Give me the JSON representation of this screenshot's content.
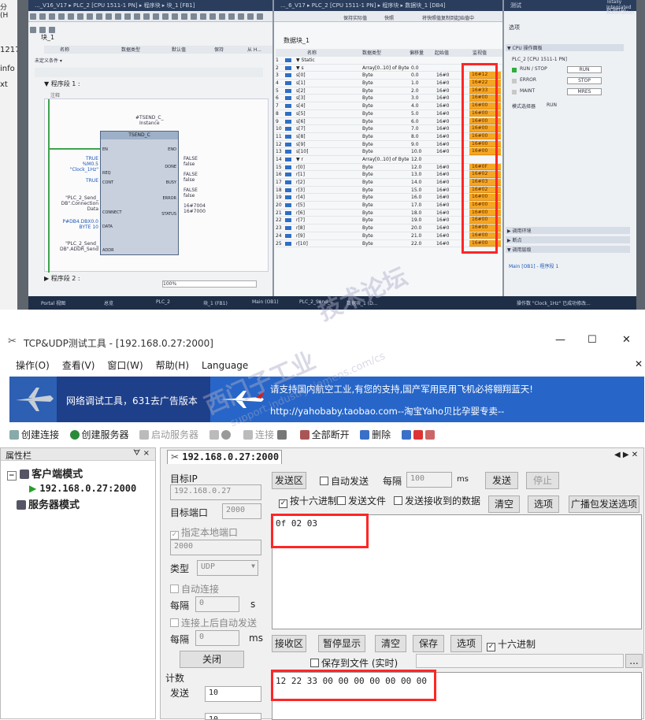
{
  "left_edge": {
    "fragments": [
      "分 (H",
      "1217",
      "info",
      "xt"
    ]
  },
  "tia": {
    "fb_title": "..._V16_V17 ▸ PLC_2 [CPU 1511-1 PN] ▸ 程序块 ▸ 块_1 [FB1]",
    "db_title": "..._6_V17 ▸ PLC_2 [CPU 1511-1 PN] ▸ 程序块 ▸ 数据块_1 [DB4]",
    "fb_header": "块_1",
    "fb_cols": [
      "名称",
      "数据类型",
      "默认值",
      "保持",
      "从 H..."
    ],
    "segment_comment": "未定义条件 ▾",
    "network1": "▼   程序段 1 :",
    "network1_comment": "注释",
    "network2": "▶   程序段 2 :",
    "zoom": "100%",
    "instance_db": "#TSEND_C_\nInstance",
    "fb_name": "TSEND_C",
    "pins_left": [
      "EN",
      "REQ",
      "CONT",
      "CONNECT",
      "DATA",
      "ADDR"
    ],
    "pins_right": [
      "ENO",
      "DONE",
      "BUSY",
      "ERROR",
      "STATUS"
    ],
    "left_values": [
      "TRUE\n%M0.5\n\"Clock_1Hz\"",
      "TRUE",
      "\"PLC_2_Send_\nDB\".Connection\nData",
      "P#DB4.DBX0.0\nBYTE 10",
      "\"PLC_2_Send_\nDB\".ADDR_Send"
    ],
    "right_values": [
      "FALSE\nfalse",
      "FALSE\nfalse",
      "FALSE\nfalse",
      "16#7004\n16#7000"
    ],
    "db_header": "数据块_1",
    "db_cols": [
      "名称",
      "数据类型",
      "偏移量",
      "起始值",
      "监视值"
    ],
    "db_toolbar": [
      "保持实际值",
      "快照",
      "将快照值复制到起始值中"
    ],
    "db_rows": [
      {
        "n": "1",
        "name": "▼ Static",
        "type": "",
        "offset": "",
        "start": "",
        "mon": ""
      },
      {
        "n": "2",
        "name": "  ▼ s",
        "type": "Array[0..10] of Byte",
        "offset": "0.0",
        "start": "",
        "mon": ""
      },
      {
        "n": "3",
        "name": "      s[0]",
        "type": "Byte",
        "offset": "0.0",
        "start": "16#0",
        "mon": "16#12"
      },
      {
        "n": "4",
        "name": "      s[1]",
        "type": "Byte",
        "offset": "1.0",
        "start": "16#0",
        "mon": "16#22"
      },
      {
        "n": "5",
        "name": "      s[2]",
        "type": "Byte",
        "offset": "2.0",
        "start": "16#0",
        "mon": "16#33"
      },
      {
        "n": "6",
        "name": "      s[3]",
        "type": "Byte",
        "offset": "3.0",
        "start": "16#0",
        "mon": "16#00"
      },
      {
        "n": "7",
        "name": "      s[4]",
        "type": "Byte",
        "offset": "4.0",
        "start": "16#0",
        "mon": "16#00"
      },
      {
        "n": "8",
        "name": "      s[5]",
        "type": "Byte",
        "offset": "5.0",
        "start": "16#0",
        "mon": "16#00"
      },
      {
        "n": "9",
        "name": "      s[6]",
        "type": "Byte",
        "offset": "6.0",
        "start": "16#0",
        "mon": "16#00"
      },
      {
        "n": "10",
        "name": "      s[7]",
        "type": "Byte",
        "offset": "7.0",
        "start": "16#0",
        "mon": "16#00"
      },
      {
        "n": "11",
        "name": "      s[8]",
        "type": "Byte",
        "offset": "8.0",
        "start": "16#0",
        "mon": "16#00"
      },
      {
        "n": "12",
        "name": "      s[9]",
        "type": "Byte",
        "offset": "9.0",
        "start": "16#0",
        "mon": "16#00"
      },
      {
        "n": "13",
        "name": "      s[10]",
        "type": "Byte",
        "offset": "10.0",
        "start": "16#0",
        "mon": "16#00"
      },
      {
        "n": "14",
        "name": "  ▼ r",
        "type": "Array[0..10] of Byte",
        "offset": "12.0",
        "start": "",
        "mon": ""
      },
      {
        "n": "15",
        "name": "      r[0]",
        "type": "Byte",
        "offset": "12.0",
        "start": "16#0",
        "mon": "16#0F"
      },
      {
        "n": "16",
        "name": "      r[1]",
        "type": "Byte",
        "offset": "13.0",
        "start": "16#0",
        "mon": "16#02"
      },
      {
        "n": "17",
        "name": "      r[2]",
        "type": "Byte",
        "offset": "14.0",
        "start": "16#0",
        "mon": "16#03"
      },
      {
        "n": "18",
        "name": "      r[3]",
        "type": "Byte",
        "offset": "15.0",
        "start": "16#0",
        "mon": "16#02"
      },
      {
        "n": "19",
        "name": "      r[4]",
        "type": "Byte",
        "offset": "16.0",
        "start": "16#0",
        "mon": "16#00"
      },
      {
        "n": "20",
        "name": "      r[5]",
        "type": "Byte",
        "offset": "17.0",
        "start": "16#0",
        "mon": "16#00"
      },
      {
        "n": "21",
        "name": "      r[6]",
        "type": "Byte",
        "offset": "18.0",
        "start": "16#0",
        "mon": "16#00"
      },
      {
        "n": "22",
        "name": "      r[7]",
        "type": "Byte",
        "offset": "19.0",
        "start": "16#0",
        "mon": "16#00"
      },
      {
        "n": "23",
        "name": "      r[8]",
        "type": "Byte",
        "offset": "20.0",
        "start": "16#0",
        "mon": "16#00"
      },
      {
        "n": "24",
        "name": "      r[9]",
        "type": "Byte",
        "offset": "21.0",
        "start": "16#0",
        "mon": "16#00"
      },
      {
        "n": "25",
        "name": "      r[10]",
        "type": "Byte",
        "offset": "22.0",
        "start": "16#0",
        "mon": "16#00"
      }
    ],
    "right_panel_title": "测试",
    "right_panel_tab": "选项",
    "cpu_panel": "▼ CPU 操作面板",
    "cpu_name": "PLC_2 [CPU 1511-1 PN]",
    "cpu_rows": [
      {
        "led": "RUN / STOP",
        "btn": "RUN"
      },
      {
        "led": "ERROR",
        "btn": "STOP"
      },
      {
        "led": "MAINT",
        "btn": "MRES"
      }
    ],
    "mode_label": "模式选择器",
    "mode_value": "RUN",
    "call_env": "▶ 调用环境",
    "breakpoint": "▶ 断点",
    "call_hierarchy": "▼ 调用层级",
    "call_item": "Main [OB1] - 程序段 1",
    "tabs_bottom": [
      "Portal 视图",
      "总览",
      "PLC_2",
      "块_1 (FB1)",
      "Main (OB1)",
      "PLC_2_Send_...",
      "数据块_1 (D..."
    ],
    "status_msg": "操作数 \"Clock_1Hz\" 已成功修改...",
    "portal_word": "PORTAL",
    "brand": "Totally Integrated Automation"
  },
  "watermark": [
    "西门子工业",
    "技术论坛",
    "support.industry.siemens.com/cs"
  ],
  "tool": {
    "title": "TCP&UDP测试工具 - [192.168.0.27:2000]",
    "menus": [
      "操作(O)",
      "查看(V)",
      "窗口(W)",
      "帮助(H)",
      "Language"
    ],
    "banner_left": "网络调试工具，631去广告版本",
    "banner_line1": "请支持国内航空工业,有您的支持,国产军用民用飞机必将翱翔蓝天!",
    "banner_line2": "http://yahobaby.taobao.com--淘宝Yaho贝比孕婴专卖--",
    "toolbar": [
      "创建连接",
      "创建服务器",
      "启动服务器",
      "连接",
      "全部断开",
      "删除"
    ],
    "sidebar_title": "属性栏",
    "sidebar_pin": "ᗊ ×",
    "tree_client": "客户端模式",
    "tree_conn": "192.168.0.27:2000",
    "tree_server": "服务器模式",
    "tab": "192.168.0.27:2000",
    "target_ip_label": "目标IP",
    "target_ip": "192.168.0.27",
    "target_port_label": "目标端口",
    "target_port": "2000",
    "local_port_label": "指定本地端口",
    "local_port": "2000",
    "type_label": "类型",
    "type": "UDP",
    "auto_connect": "自动连接",
    "interval_label": "每隔",
    "interval1": "0",
    "unit_s": "s",
    "auto_send_after": "连接上后自动发送",
    "interval2": "0",
    "unit_ms": "ms",
    "close_btn": "关闭",
    "count_label": "计数",
    "send_label": "发送",
    "send_count": "10",
    "recv_count": "10",
    "send_area": "发送区",
    "auto_send": "自动发送",
    "every": "每隔",
    "every_val": "100",
    "ms": "ms",
    "send_btn": "发送",
    "stop_btn": "停止",
    "hex_send": "按十六进制",
    "send_file": "发送文件",
    "send_received": "发送接收到的数据",
    "clear_btn": "清空",
    "options_btn": "选项",
    "broadcast_btn": "广播包发送选项",
    "send_data": "0f 02 03",
    "recv_area": "接收区",
    "pause_btn": "暂停显示",
    "clear2": "清空",
    "save_btn": "保存",
    "options2": "选项",
    "hex_recv": "十六进制",
    "save_file": "保存到文件 (实时)",
    "browse": "...",
    "recv_data": "12 22 33 00 00 00 00 00 00 00",
    "win_min": "—",
    "win_max": "☐",
    "win_close": "✕",
    "tab_arrows": "◀ ▶ ✕"
  },
  "colors": {
    "monitor": "#f5a623",
    "highlight": "#ff2626",
    "banner": "#1e3f8a"
  }
}
